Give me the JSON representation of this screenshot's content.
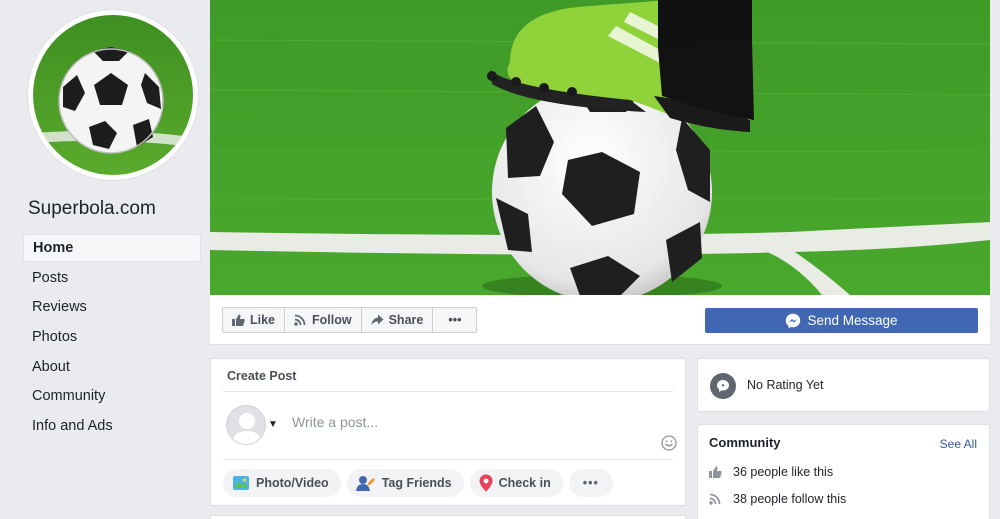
{
  "page": {
    "name": "Superbola.com"
  },
  "nav": {
    "items": [
      {
        "label": "Home"
      },
      {
        "label": "Posts"
      },
      {
        "label": "Reviews"
      },
      {
        "label": "Photos"
      },
      {
        "label": "About"
      },
      {
        "label": "Community"
      },
      {
        "label": "Info and Ads"
      }
    ]
  },
  "actions": {
    "like": "Like",
    "follow": "Follow",
    "share": "Share",
    "more": "•••",
    "send_message": "Send Message"
  },
  "create_post": {
    "title": "Create Post",
    "placeholder": "Write a post...",
    "photo_video": "Photo/Video",
    "tag_friends": "Tag Friends",
    "check_in": "Check in",
    "more": "•••"
  },
  "rating": {
    "text": "No Rating Yet"
  },
  "community": {
    "title": "Community",
    "see_all": "See All",
    "likes": "36 people like this",
    "follows": "38 people follow this"
  },
  "colors": {
    "brand": "#4267b2",
    "link": "#385898",
    "background": "#e9ebee"
  }
}
